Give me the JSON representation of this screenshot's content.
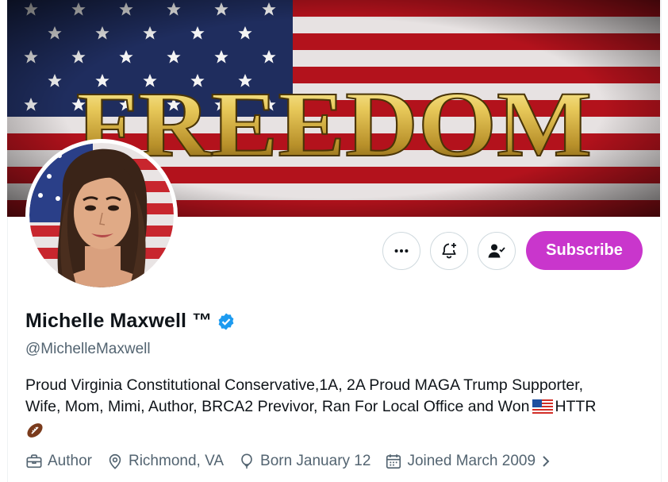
{
  "banner": {
    "text": "FREEDOM"
  },
  "actions": {
    "subscribe_label": "Subscribe"
  },
  "profile": {
    "name": "Michelle Maxwell ™",
    "handle": "@MichelleMaxwell",
    "bio_line1": "Proud Virginia Constitutional Conservative,1A, 2A Proud MAGA Trump Supporter,",
    "bio_line2": "Wife, Mom, Mimi, Author, BRCA2 Previvor, Ran For Local Office and Won",
    "bio_line2_suffix": "HTTR"
  },
  "meta": {
    "profession": "Author",
    "location": "Richmond, VA",
    "birthday": "Born January 12",
    "joined": "Joined March 2009"
  },
  "colors": {
    "subscribe": "#c936cc",
    "verified": "#1d9bf0",
    "muted": "#536471"
  }
}
